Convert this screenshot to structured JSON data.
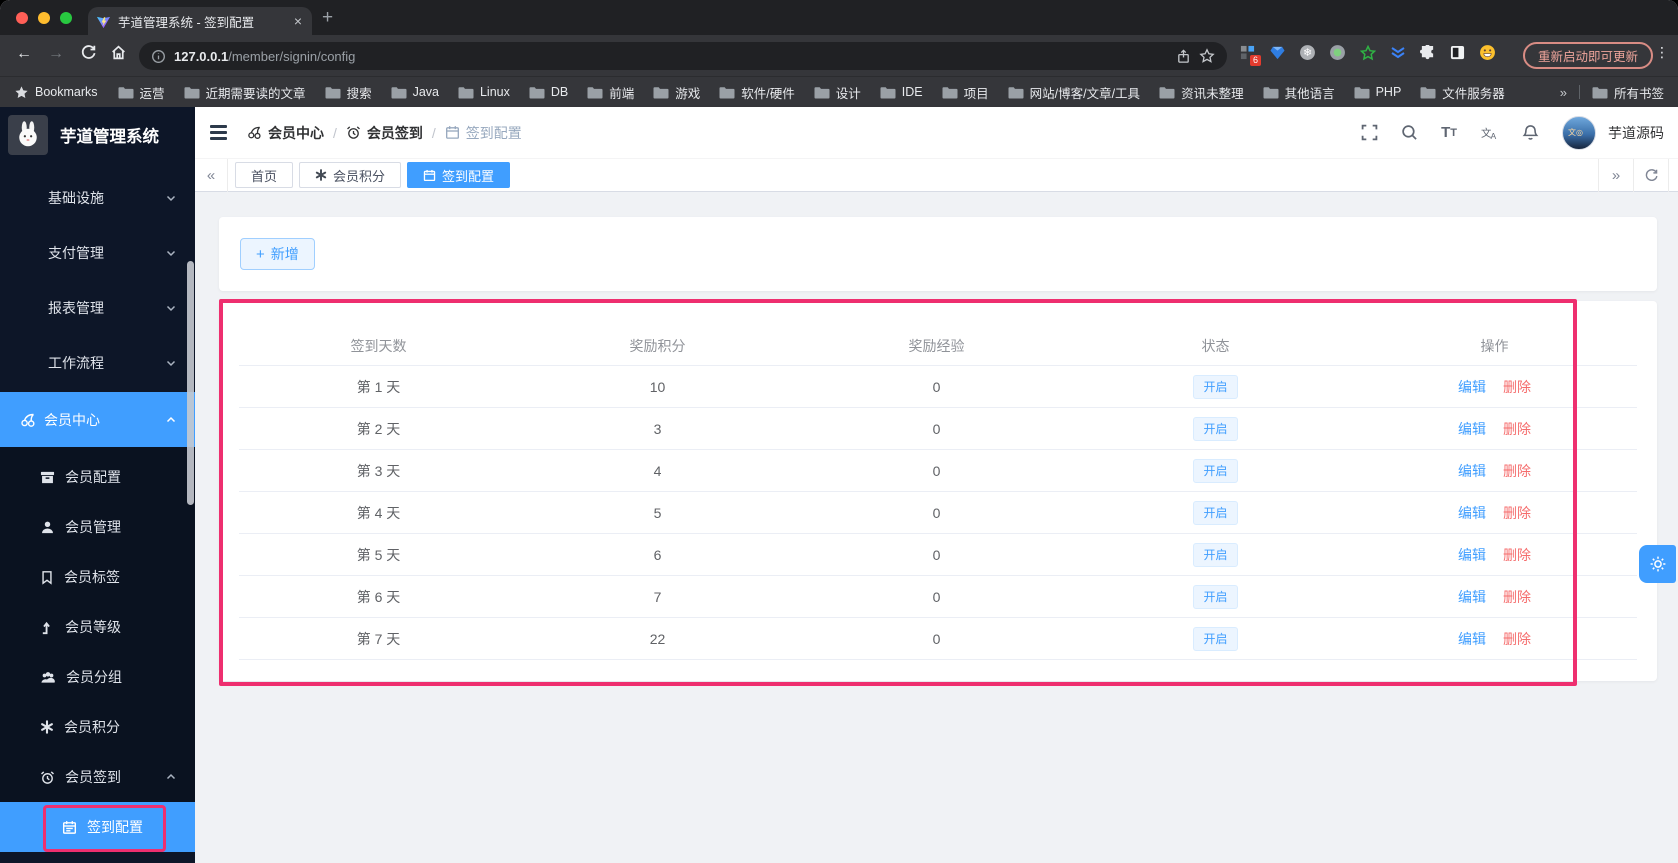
{
  "browser": {
    "tab_title": "芋道管理系统 - 签到配置",
    "close_glyph": "×",
    "new_tab_glyph": "+",
    "back_glyph": "←",
    "forward_glyph": "→",
    "url_host": "127.0.0.1",
    "url_path": "/member/signin/config",
    "extension_badge": "6",
    "update_button": "重新启动即可更新",
    "menu_glyph": "⋮",
    "bookmarks_label": "Bookmarks",
    "bookmark_folders": [
      "运营",
      "近期需要读的文章",
      "搜索",
      "Java",
      "Linux",
      "DB",
      "前端",
      "游戏",
      "软件/硬件",
      "设计",
      "IDE",
      "项目",
      "网站/博客/文章/工具",
      "资讯未整理",
      "其他语言",
      "PHP",
      "文件服务器"
    ],
    "overflow_glyph": "»",
    "all_bookmarks_label": "所有书签"
  },
  "sidebar": {
    "logo_title": "芋道管理系统",
    "top_items": [
      {
        "label": "基础设施"
      },
      {
        "label": "支付管理"
      },
      {
        "label": "报表管理"
      },
      {
        "label": "工作流程"
      }
    ],
    "active_parent": {
      "label": "会员中心"
    },
    "sub_items": [
      {
        "label": "会员配置"
      },
      {
        "label": "会员管理"
      },
      {
        "label": "会员标签"
      },
      {
        "label": "会员等级"
      },
      {
        "label": "会员分组"
      },
      {
        "label": "会员积分"
      },
      {
        "label": "会员签到"
      }
    ],
    "active_sub": {
      "label": "签到配置"
    }
  },
  "header": {
    "breadcrumb": [
      {
        "label": "会员中心"
      },
      {
        "label": "会员签到"
      },
      {
        "label": "签到配置"
      }
    ],
    "separator": "/",
    "username": "芋道源码"
  },
  "tags_bar": {
    "collapse_left_glyph": "«",
    "collapse_right_glyph": "»",
    "tabs": [
      {
        "label": "首页"
      },
      {
        "label": "会员积分"
      },
      {
        "label": "签到配置"
      }
    ]
  },
  "toolbar": {
    "add_label": "新增",
    "plus_glyph": "+"
  },
  "table": {
    "headers": [
      "签到天数",
      "奖励积分",
      "奖励经验",
      "状态",
      "操作"
    ],
    "rows": [
      {
        "day": "第 1 天",
        "points": "10",
        "exp": "0",
        "status": "开启"
      },
      {
        "day": "第 2 天",
        "points": "3",
        "exp": "0",
        "status": "开启"
      },
      {
        "day": "第 3 天",
        "points": "4",
        "exp": "0",
        "status": "开启"
      },
      {
        "day": "第 4 天",
        "points": "5",
        "exp": "0",
        "status": "开启"
      },
      {
        "day": "第 5 天",
        "points": "6",
        "exp": "0",
        "status": "开启"
      },
      {
        "day": "第 6 天",
        "points": "7",
        "exp": "0",
        "status": "开启"
      },
      {
        "day": "第 7 天",
        "points": "22",
        "exp": "0",
        "status": "开启"
      }
    ],
    "edit_label": "编辑",
    "delete_label": "删除"
  },
  "colors": {
    "accent": "#409eff",
    "annotation": "#ee2f6f",
    "danger": "#f56c6c",
    "sidebar_bg": "#0d1628",
    "tag_bg": "#ecf5ff"
  }
}
